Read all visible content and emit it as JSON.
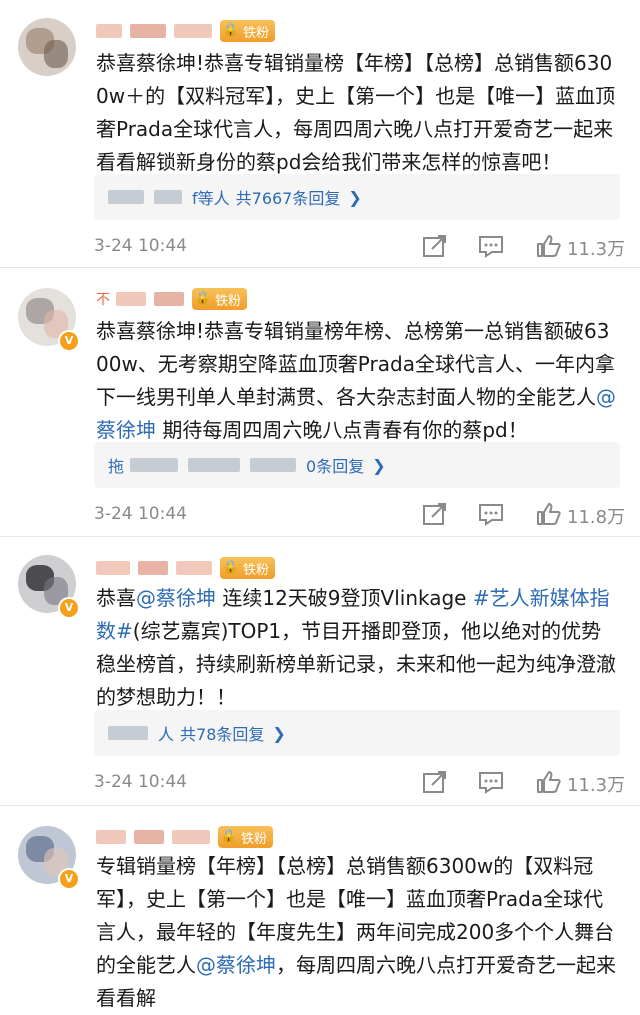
{
  "badge_label": "铁粉",
  "colors": {
    "link": "#2e6bb5",
    "badge": "#f19d2a",
    "meta": "#8a8a8a"
  },
  "icons": {
    "share": "share-icon",
    "comment": "comment-icon",
    "like": "thumbs-up-icon"
  },
  "comments": [
    {
      "name_visible": "",
      "text": "恭喜蔡徐坤!恭喜专辑销量榜【年榜】【总榜】总销售额6300w＋的【双料冠军】，史上【第一个】也是【唯一】蓝血顶奢Prada全球代言人，每周四周六晚八点打开爱奇艺一起来看看解锁新身份的蔡pd会给我们带来怎样的惊喜吧！",
      "reply_prefix": "f等人",
      "reply_count": "共7667条回复",
      "time": "3-24 10:44",
      "likes": "11.3万"
    },
    {
      "name_visible": "不",
      "text_a": "恭喜蔡徐坤!恭喜专辑销量榜年榜、总榜第一总销售额破6300w、无考察期空降蓝血顶奢Prada全球代言人、一年内拿下一线男刊单人单封满贯、各大杂志封面人物的全能艺人",
      "mention": "@蔡徐坤",
      "text_b": " 期待每周四周六晚八点青春有你的蔡pd！",
      "reply_prefix": "拖",
      "reply_count": "0条回复",
      "time": "3-24 10:44",
      "likes": "11.8万"
    },
    {
      "text_a": "恭喜",
      "mention": "@蔡徐坤",
      "text_b": " 连续12天破9登顶Vlinkage ",
      "topic": "#艺人新媒体指数#",
      "text_c": "(综艺嘉宾)TOP1，节目开播即登顶，他以绝对的优势稳坐榜首，持续刷新榜单新记录，未来和他一起为纯净澄澈的梦想助力！！",
      "reply_prefix": "人",
      "reply_count": "共78条回复",
      "time": "3-24 10:44",
      "likes": "11.3万"
    },
    {
      "text_a": "专辑销量榜【年榜】【总榜】总销售额6300w的【双料冠军】，史上【第一个】也是【唯一】蓝血顶奢Prada全球代言人，最年轻的【年度先生】两年间完成200多个个人舞台的全能艺人",
      "mention": "@蔡徐坤",
      "text_b": "，每周四周六晚八点打开爱奇艺一起来看看解"
    }
  ]
}
